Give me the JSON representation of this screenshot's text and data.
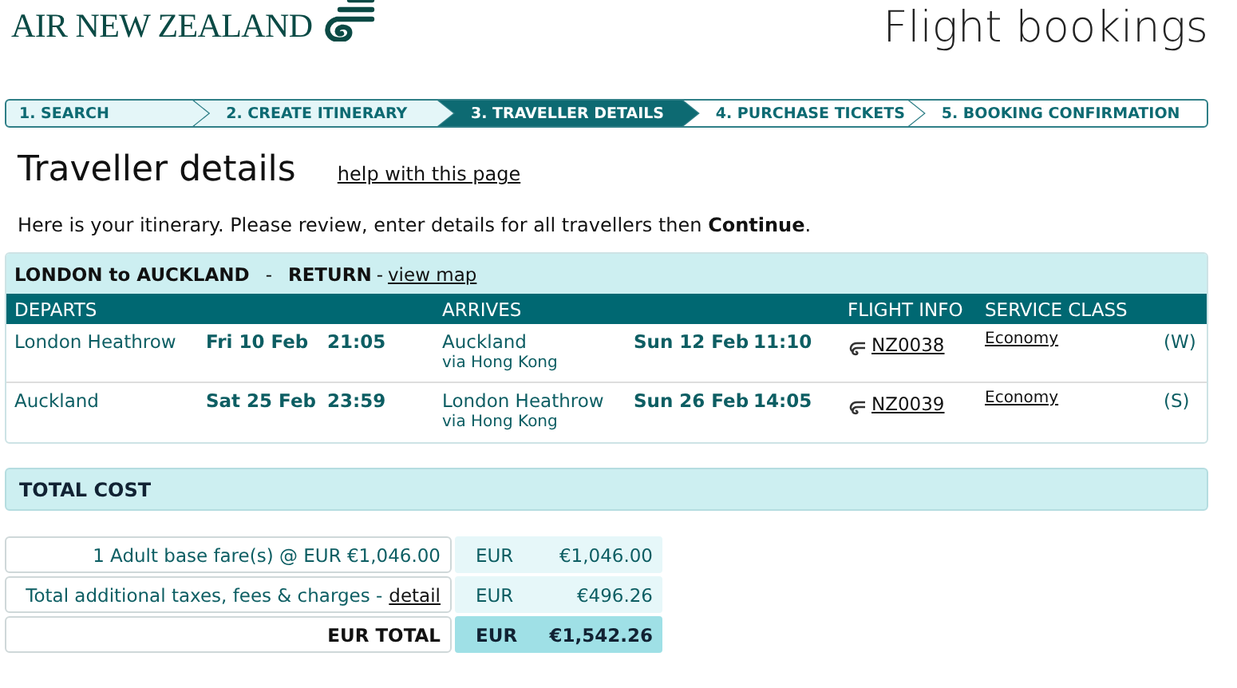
{
  "brand": {
    "name": "AIR NEW ZEALAND",
    "section": "Flight bookings"
  },
  "steps": [
    {
      "label": "1. SEARCH",
      "selected": false,
      "done": true
    },
    {
      "label": "2. CREATE ITINERARY",
      "selected": false,
      "done": true
    },
    {
      "label": "3. TRAVELLER DETAILS",
      "selected": true,
      "done": false
    },
    {
      "label": "4. PURCHASE TICKETS",
      "selected": false,
      "done": false
    },
    {
      "label": "5. BOOKING CONFIRMATION",
      "selected": false,
      "done": false
    }
  ],
  "heading": "Traveller details",
  "help_link": "help with this page",
  "intro": "Here is your itinerary. Please review, enter details for all travellers then **Continue**.",
  "itinerary": {
    "route": "LONDON to AUCKLAND",
    "separator": "-",
    "trip_type": "RETURN",
    "map_prefix": "-",
    "map_link": "view map",
    "columns": [
      "DEPARTS",
      "ARRIVES",
      "FLIGHT INFO",
      "SERVICE CLASS"
    ],
    "rows": [
      {
        "from": "London Heathrow",
        "dep_date": "Fri 10 Feb",
        "dep_time": "21:05",
        "to": "Auckland",
        "via": "via Hong Kong",
        "arr_date": "Sun 12 Feb",
        "arr_time": "11:10",
        "flight": "NZ0038",
        "class": "Economy",
        "fare_code": "(W)"
      },
      {
        "from": "Auckland",
        "dep_date": "Sat 25 Feb",
        "dep_time": "23:59",
        "to": "London Heathrow",
        "via": "via Hong Kong",
        "arr_date": "Sun 26 Feb",
        "arr_time": "14:05",
        "flight": "NZ0039",
        "class": "Economy",
        "fare_code": "(S)"
      }
    ]
  },
  "total_cost": {
    "title": "TOTAL COST",
    "rows": [
      {
        "kind": "line",
        "label": "1 Adult base fare(s) @ EUR €1,046.00",
        "currency": "EUR",
        "amount": "€1,046.00"
      },
      {
        "kind": "line",
        "label": "Total additional taxes, fees & charges -",
        "link": "detail",
        "currency": "EUR",
        "amount": "€496.26"
      },
      {
        "kind": "total",
        "label": "EUR TOTAL",
        "currency": "EUR",
        "amount": "€1,542.26"
      }
    ]
  }
}
